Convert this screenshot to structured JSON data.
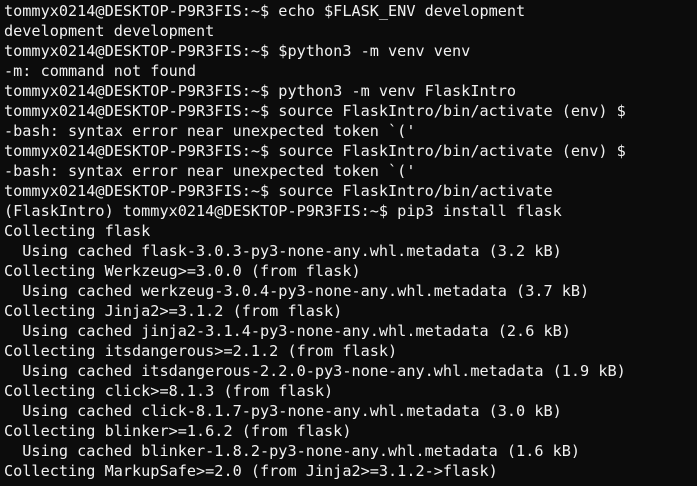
{
  "terminal": {
    "lines": [
      {
        "text": "tommyx0214@DESKTOP-P9R3FIS:~$ echo $FLASK_ENV development",
        "kind": "command"
      },
      {
        "text": "development development",
        "kind": "output"
      },
      {
        "text": "tommyx0214@DESKTOP-P9R3FIS:~$ $python3 -m venv venv",
        "kind": "command"
      },
      {
        "text": "-m: command not found",
        "kind": "output"
      },
      {
        "text": "tommyx0214@DESKTOP-P9R3FIS:~$ python3 -m venv FlaskIntro",
        "kind": "command"
      },
      {
        "text": "tommyx0214@DESKTOP-P9R3FIS:~$ source FlaskIntro/bin/activate (env) $",
        "kind": "command"
      },
      {
        "text": "-bash: syntax error near unexpected token `('",
        "kind": "output"
      },
      {
        "text": "tommyx0214@DESKTOP-P9R3FIS:~$ source FlaskIntro/bin/activate (env) $",
        "kind": "command"
      },
      {
        "text": "-bash: syntax error near unexpected token `('",
        "kind": "output"
      },
      {
        "text": "tommyx0214@DESKTOP-P9R3FIS:~$ source FlaskIntro/bin/activate",
        "kind": "command"
      },
      {
        "text": "(FlaskIntro) tommyx0214@DESKTOP-P9R3FIS:~$ pip3 install flask",
        "kind": "command"
      },
      {
        "text": "Collecting flask",
        "kind": "output"
      },
      {
        "text": "  Using cached flask-3.0.3-py3-none-any.whl.metadata (3.2 kB)",
        "kind": "output"
      },
      {
        "text": "Collecting Werkzeug>=3.0.0 (from flask)",
        "kind": "output"
      },
      {
        "text": "  Using cached werkzeug-3.0.4-py3-none-any.whl.metadata (3.7 kB)",
        "kind": "output"
      },
      {
        "text": "Collecting Jinja2>=3.1.2 (from flask)",
        "kind": "output"
      },
      {
        "text": "  Using cached jinja2-3.1.4-py3-none-any.whl.metadata (2.6 kB)",
        "kind": "output"
      },
      {
        "text": "Collecting itsdangerous>=2.1.2 (from flask)",
        "kind": "output"
      },
      {
        "text": "  Using cached itsdangerous-2.2.0-py3-none-any.whl.metadata (1.9 kB)",
        "kind": "output"
      },
      {
        "text": "Collecting click>=8.1.3 (from flask)",
        "kind": "output"
      },
      {
        "text": "  Using cached click-8.1.7-py3-none-any.whl.metadata (3.0 kB)",
        "kind": "output"
      },
      {
        "text": "Collecting blinker>=1.6.2 (from flask)",
        "kind": "output"
      },
      {
        "text": "  Using cached blinker-1.8.2-py3-none-any.whl.metadata (1.6 kB)",
        "kind": "output"
      },
      {
        "text": "Collecting MarkupSafe>=2.0 (from Jinja2>=3.1.2->flask)",
        "kind": "output"
      }
    ]
  },
  "colors": {
    "background": "#0c0c0c",
    "foreground": "#f2f2f2"
  }
}
